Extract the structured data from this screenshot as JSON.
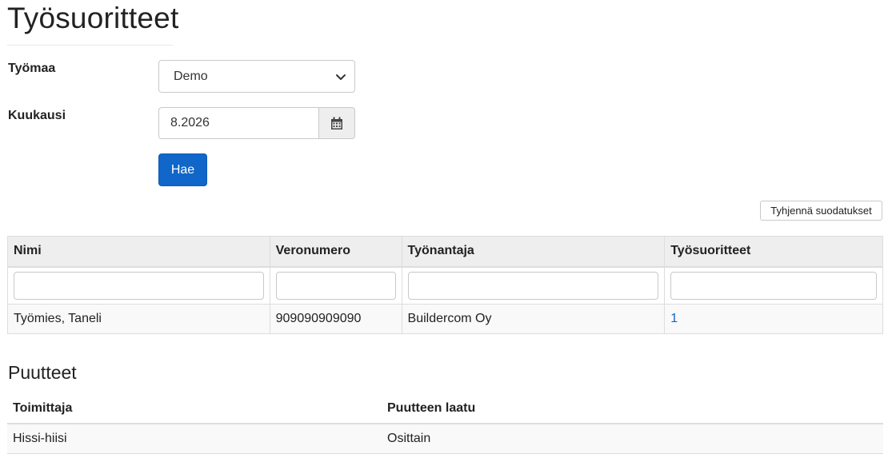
{
  "page": {
    "title": "Työsuoritteet"
  },
  "filters": {
    "site_label": "Työmaa",
    "site_value": "Demo",
    "month_label": "Kuukausi",
    "month_value": "8.2026",
    "search_button": "Hae",
    "clear_button": "Tyhjennä suodatukset"
  },
  "grid": {
    "columns": [
      "Nimi",
      "Veronumero",
      "Työnantaja",
      "Työsuoritteet"
    ],
    "filter_values": [
      "",
      "",
      "",
      ""
    ],
    "rows": [
      {
        "name": "Työmies, Taneli",
        "tax_number": "909090909090",
        "employer": "Buildercom Oy",
        "count": "1"
      }
    ]
  },
  "deficiencies": {
    "title": "Puutteet",
    "columns": [
      "Toimittaja",
      "Puutteen laatu"
    ],
    "rows": [
      {
        "supplier": "Hissi-hiisi",
        "quality": "Osittain"
      }
    ]
  },
  "icons": {
    "select_chevron": "chevron-down-icon",
    "calendar": "calendar-icon"
  },
  "colors": {
    "primary": "#1066c9",
    "header_bg": "#eeeeee",
    "row_bg": "#f9f9f9",
    "border": "#dddddd"
  }
}
